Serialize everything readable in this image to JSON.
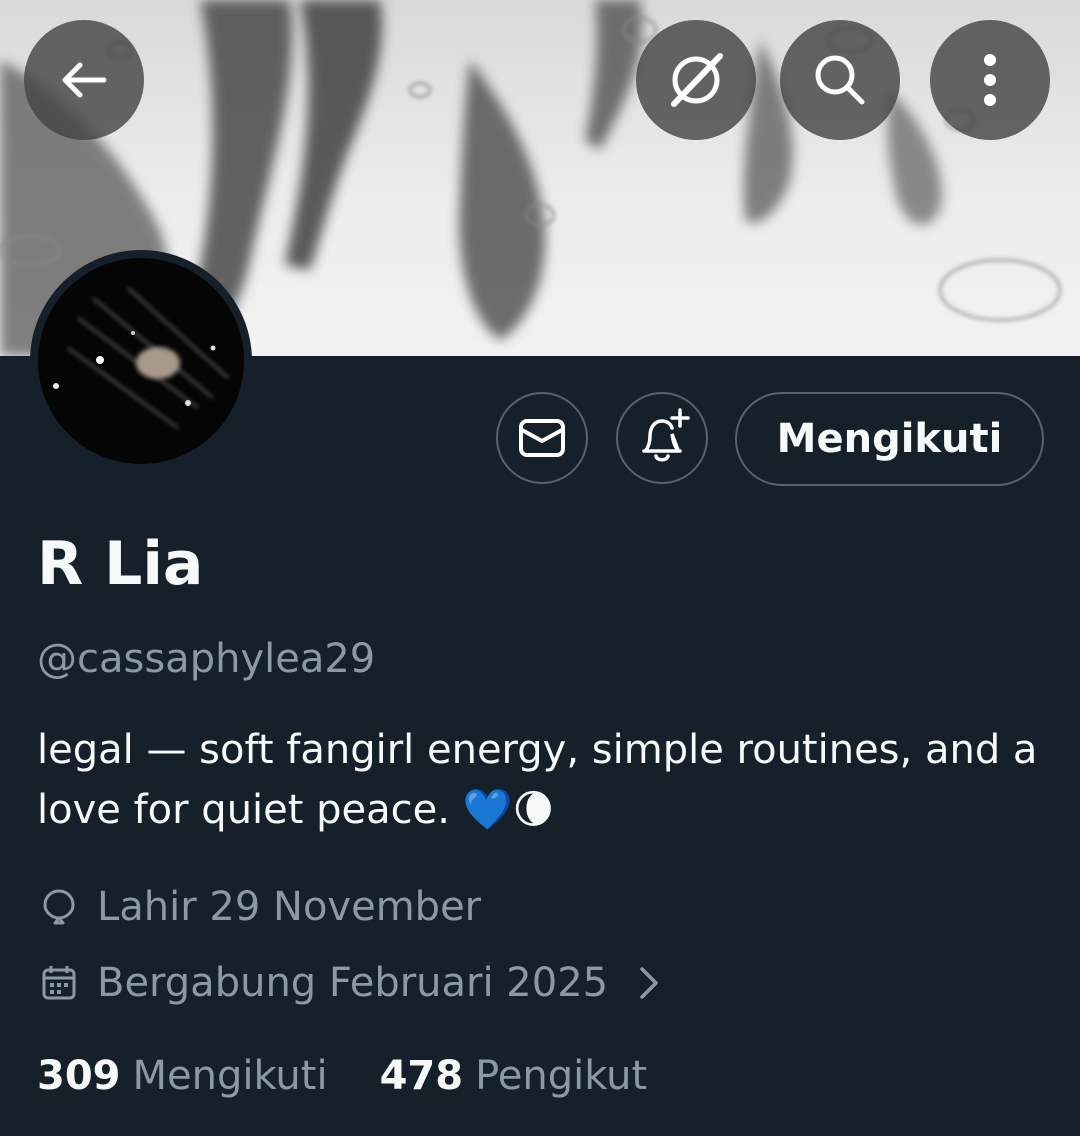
{
  "header": {
    "back_icon": "arrow-left-icon",
    "grok_icon": "grok-icon",
    "search_icon": "search-icon",
    "more_icon": "more-vertical-icon"
  },
  "actions": {
    "message_icon": "envelope-icon",
    "notify_icon": "bell-plus-icon",
    "follow_label": "Mengikuti"
  },
  "profile": {
    "name": "R Lia",
    "handle": "@cassaphylea29",
    "bio": "legal — soft fangirl energy, simple routines, and a love for quiet peace. 💙🌘",
    "birthday": "Lahir 29 November",
    "joined": "Bergabung Februari 2025"
  },
  "stats": {
    "following_count": "309",
    "following_label": "Mengikuti",
    "followers_count": "478",
    "followers_label": "Pengikut"
  },
  "colors": {
    "background": "#15202b",
    "text": "#f7f9f9",
    "muted": "#8b98a5",
    "border": "#536471"
  }
}
